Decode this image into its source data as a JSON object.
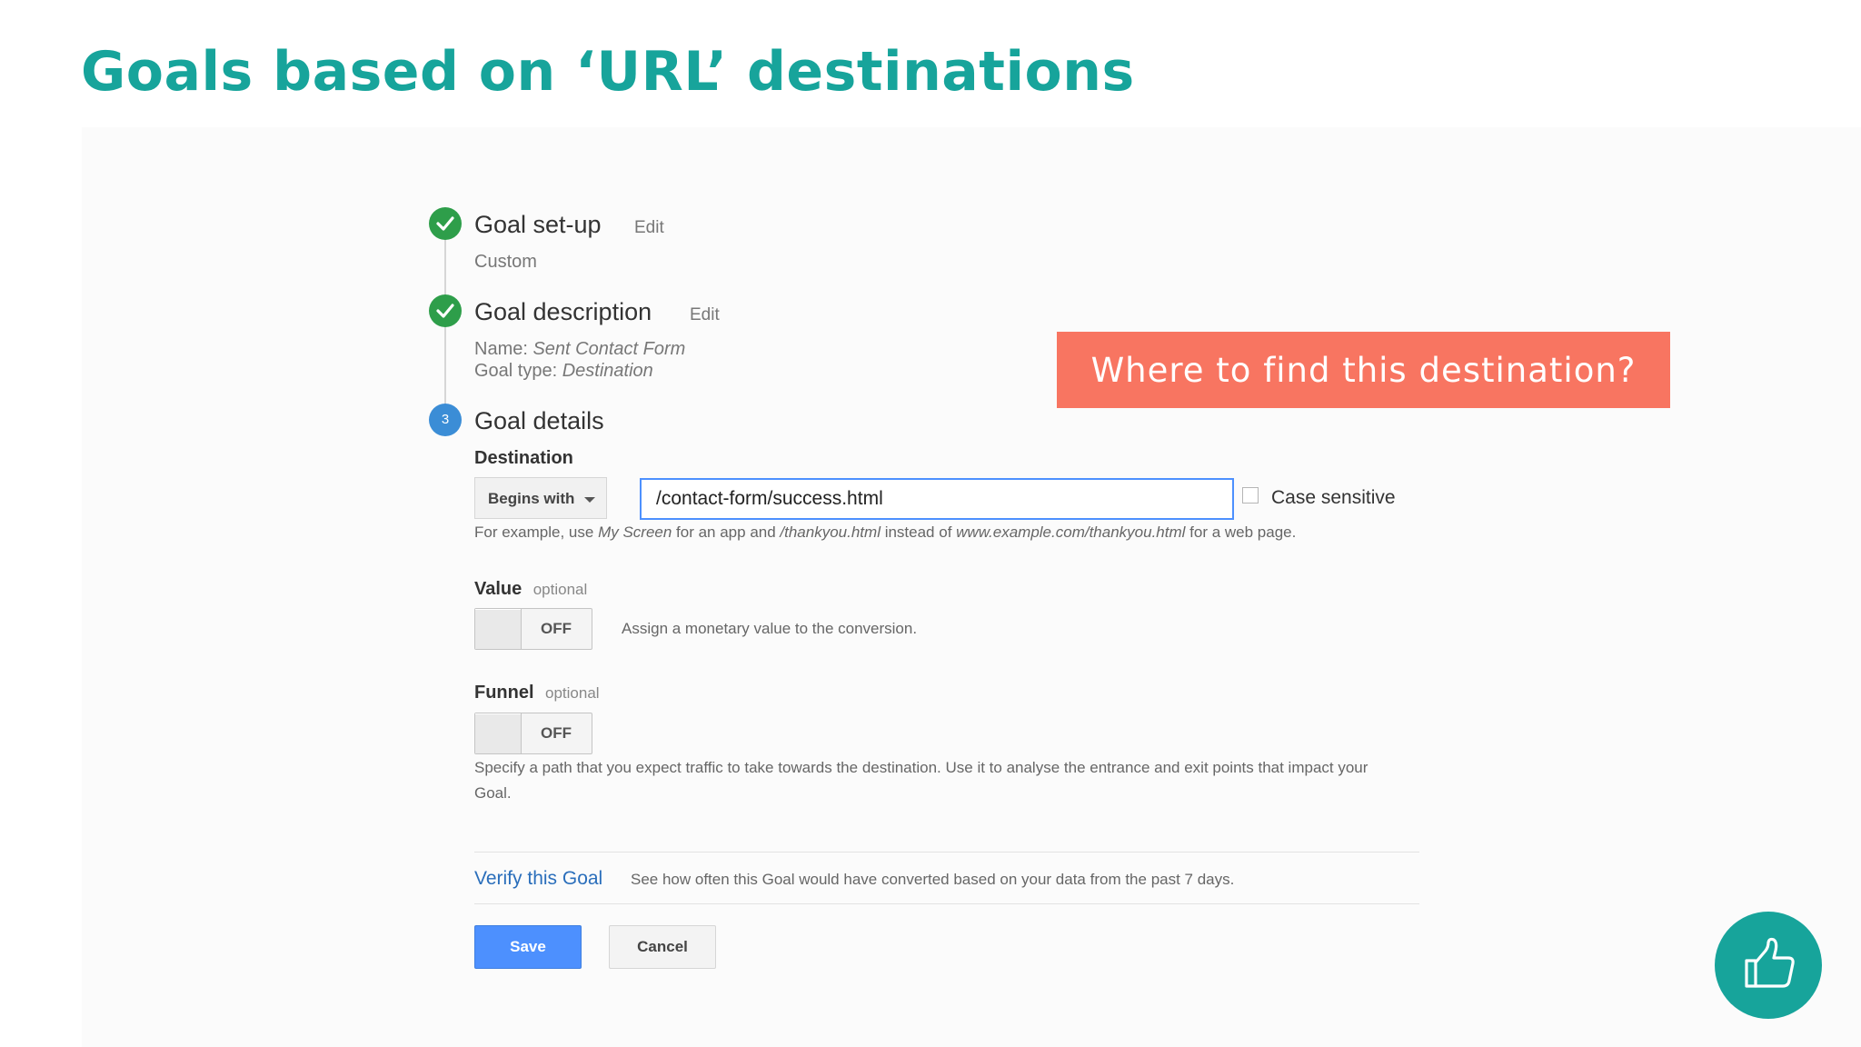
{
  "slide": {
    "title": "Goals based on ‘URL’ destinations"
  },
  "steps": [
    {
      "title": "Goal set-up",
      "edit": "Edit",
      "subtitle": "Custom"
    },
    {
      "title": "Goal description",
      "edit": "Edit",
      "name_label": "Name:",
      "name_value": "Sent Contact Form",
      "type_label": "Goal type:",
      "type_value": "Destination"
    },
    {
      "number": "3",
      "title": "Goal details"
    }
  ],
  "destination": {
    "label": "Destination",
    "match_type": "Begins with",
    "value": "/contact-form/success.html",
    "case_sensitive_label": "Case sensitive",
    "case_sensitive_checked": false,
    "hint": {
      "t1": "For example, use ",
      "i1": "My Screen",
      "t2": " for an app and ",
      "i2": "/thankyou.html",
      "t3": " instead of ",
      "i3": "www.example.com/thankyou.html",
      "t4": " for a web page."
    }
  },
  "value_section": {
    "label": "Value",
    "optional": "optional",
    "toggle": "OFF",
    "description": "Assign a monetary value to the conversion."
  },
  "funnel_section": {
    "label": "Funnel",
    "optional": "optional",
    "toggle": "OFF",
    "description_line1": "Specify a path that you expect traffic to take towards the destination. Use it to analyse the entrance and exit points that impact your",
    "description_line2": "Goal."
  },
  "verify": {
    "link": "Verify this Goal",
    "description": "See how often this Goal would have converted based on your data from the past 7 days."
  },
  "buttons": {
    "save": "Save",
    "cancel": "Cancel"
  },
  "callout": {
    "text": "Where to find this destination?"
  },
  "colors": {
    "title": "#17a49b",
    "callout": "#f87561",
    "check": "#2e9e4a",
    "step_active": "#3b8dd6",
    "primary_button": "#4d90fe",
    "link": "#2a6ebb"
  },
  "icons": {
    "step_done": "check-icon",
    "feedback": "thumbs-up-icon",
    "dropdown": "caret-down-icon"
  }
}
